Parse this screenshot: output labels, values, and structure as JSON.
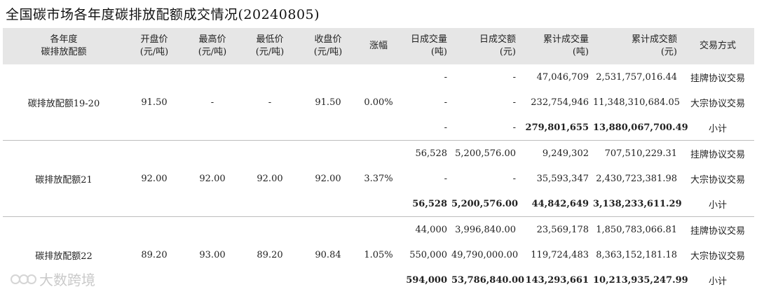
{
  "title": "全国碳市场各年度碳排放配额成交情况(20240805)",
  "headers": [
    [
      "各年度",
      "碳排放配额"
    ],
    [
      "开盘价",
      "(元/吨)"
    ],
    [
      "最高价",
      "(元/吨)"
    ],
    [
      "最低价",
      "(元/吨)"
    ],
    [
      "收盘价",
      "(元/吨)"
    ],
    [
      "涨幅"
    ],
    [
      "日成交量",
      "(吨)"
    ],
    [
      "日成交额",
      "(元)"
    ],
    [
      "累计成交量",
      "(吨)"
    ],
    [
      "累计成交额",
      "(元)"
    ],
    [
      "交易方式"
    ]
  ],
  "groups": [
    {
      "name": "碳排放配额19-20",
      "open": "91.50",
      "high": "-",
      "low": "-",
      "close": "91.50",
      "change": "0.00%",
      "rows": [
        {
          "day_volume": "-",
          "day_amount": "-",
          "cum_volume": "47,046,709",
          "cum_amount": "2,531,757,016.44",
          "method": "挂牌协议交易"
        },
        {
          "day_volume": "-",
          "day_amount": "-",
          "cum_volume": "232,754,946",
          "cum_amount": "11,348,310,684.05",
          "method": "大宗协议交易"
        },
        {
          "day_volume": "-",
          "day_amount": "-",
          "cum_volume": "279,801,655",
          "cum_amount": "13,880,067,700.49",
          "method": "小计"
        }
      ]
    },
    {
      "name": "碳排放配额21",
      "open": "92.00",
      "high": "92.00",
      "low": "92.00",
      "close": "92.00",
      "change": "3.37%",
      "rows": [
        {
          "day_volume": "56,528",
          "day_amount": "5,200,576.00",
          "cum_volume": "9,249,302",
          "cum_amount": "707,510,229.31",
          "method": "挂牌协议交易"
        },
        {
          "day_volume": "-",
          "day_amount": "-",
          "cum_volume": "35,593,347",
          "cum_amount": "2,430,723,381.98",
          "method": "大宗协议交易"
        },
        {
          "day_volume": "56,528",
          "day_amount": "5,200,576.00",
          "cum_volume": "44,842,649",
          "cum_amount": "3,138,233,611.29",
          "method": "小计"
        }
      ]
    },
    {
      "name": "碳排放配额22",
      "open": "89.20",
      "high": "93.00",
      "low": "89.20",
      "close": "90.84",
      "change": "1.05%",
      "rows": [
        {
          "day_volume": "44,000",
          "day_amount": "3,996,840.00",
          "cum_volume": "23,569,178",
          "cum_amount": "1,850,783,066.81",
          "method": "挂牌协议交易"
        },
        {
          "day_volume": "550,000",
          "day_amount": "49,790,000.00",
          "cum_volume": "119,724,483",
          "cum_amount": "8,363,152,181.18",
          "method": "大宗协议交易"
        },
        {
          "day_volume": "594,000",
          "day_amount": "53,786,840.00",
          "cum_volume": "143,293,661",
          "cum_amount": "10,213,935,247.99",
          "method": "小计"
        }
      ]
    }
  ],
  "watermark": "大数跨境"
}
